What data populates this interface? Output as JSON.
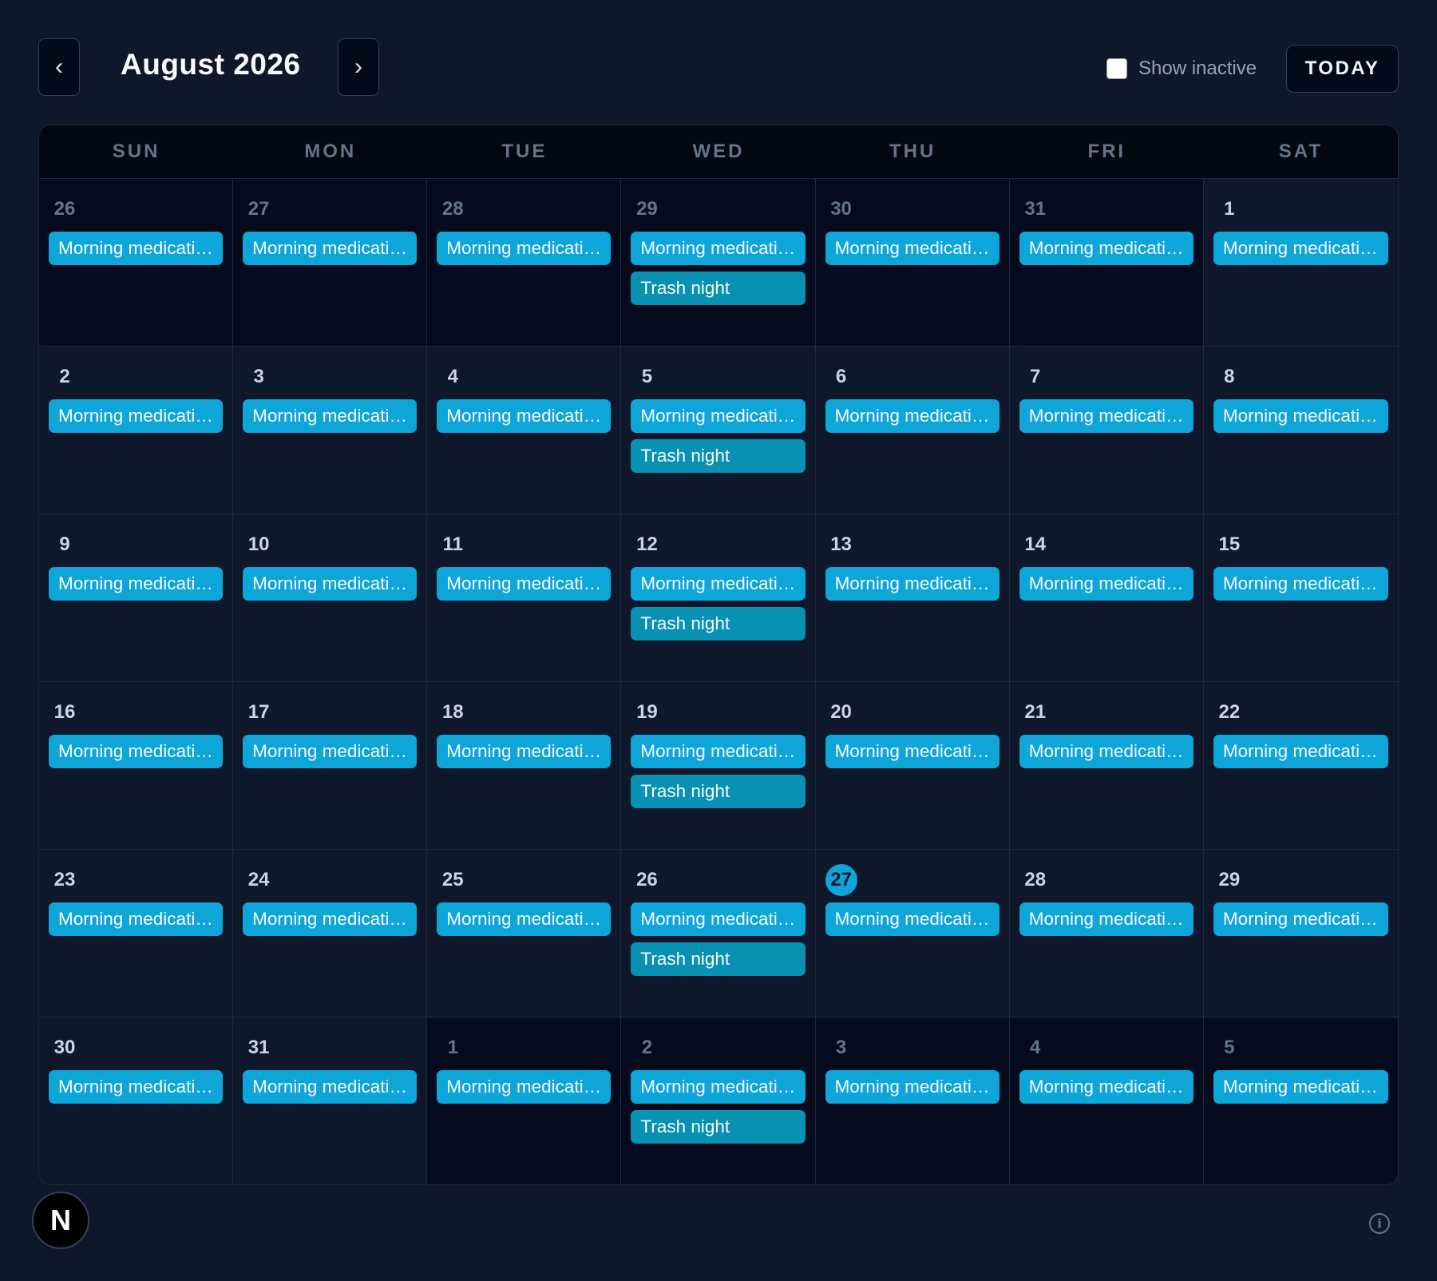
{
  "header": {
    "prev_label": "‹",
    "next_label": "›",
    "month_title": "August 2026",
    "show_inactive_label": "Show inactive",
    "show_inactive_checked": false,
    "today_label": "TODAY"
  },
  "weekdays": [
    "SUN",
    "MON",
    "TUE",
    "WED",
    "THU",
    "FRI",
    "SAT"
  ],
  "events": {
    "morning": "Morning medication",
    "trash": "Trash night"
  },
  "today_day": 27,
  "weeks": [
    [
      {
        "day": "26",
        "other": true,
        "events": [
          "morning"
        ]
      },
      {
        "day": "27",
        "other": true,
        "events": [
          "morning"
        ]
      },
      {
        "day": "28",
        "other": true,
        "events": [
          "morning"
        ]
      },
      {
        "day": "29",
        "other": true,
        "events": [
          "morning",
          "trash"
        ]
      },
      {
        "day": "30",
        "other": true,
        "events": [
          "morning"
        ]
      },
      {
        "day": "31",
        "other": true,
        "events": [
          "morning"
        ]
      },
      {
        "day": "1",
        "other": false,
        "events": [
          "morning"
        ]
      }
    ],
    [
      {
        "day": "2",
        "other": false,
        "events": [
          "morning"
        ]
      },
      {
        "day": "3",
        "other": false,
        "events": [
          "morning"
        ]
      },
      {
        "day": "4",
        "other": false,
        "events": [
          "morning"
        ]
      },
      {
        "day": "5",
        "other": false,
        "events": [
          "morning",
          "trash"
        ]
      },
      {
        "day": "6",
        "other": false,
        "events": [
          "morning"
        ]
      },
      {
        "day": "7",
        "other": false,
        "events": [
          "morning"
        ]
      },
      {
        "day": "8",
        "other": false,
        "events": [
          "morning"
        ]
      }
    ],
    [
      {
        "day": "9",
        "other": false,
        "events": [
          "morning"
        ]
      },
      {
        "day": "10",
        "other": false,
        "events": [
          "morning"
        ]
      },
      {
        "day": "11",
        "other": false,
        "events": [
          "morning"
        ]
      },
      {
        "day": "12",
        "other": false,
        "events": [
          "morning",
          "trash"
        ]
      },
      {
        "day": "13",
        "other": false,
        "events": [
          "morning"
        ]
      },
      {
        "day": "14",
        "other": false,
        "events": [
          "morning"
        ]
      },
      {
        "day": "15",
        "other": false,
        "events": [
          "morning"
        ]
      }
    ],
    [
      {
        "day": "16",
        "other": false,
        "events": [
          "morning"
        ]
      },
      {
        "day": "17",
        "other": false,
        "events": [
          "morning"
        ]
      },
      {
        "day": "18",
        "other": false,
        "events": [
          "morning"
        ]
      },
      {
        "day": "19",
        "other": false,
        "events": [
          "morning",
          "trash"
        ]
      },
      {
        "day": "20",
        "other": false,
        "events": [
          "morning"
        ]
      },
      {
        "day": "21",
        "other": false,
        "events": [
          "morning"
        ]
      },
      {
        "day": "22",
        "other": false,
        "events": [
          "morning"
        ]
      }
    ],
    [
      {
        "day": "23",
        "other": false,
        "events": [
          "morning"
        ]
      },
      {
        "day": "24",
        "other": false,
        "events": [
          "morning"
        ]
      },
      {
        "day": "25",
        "other": false,
        "events": [
          "morning"
        ]
      },
      {
        "day": "26",
        "other": false,
        "events": [
          "morning",
          "trash"
        ]
      },
      {
        "day": "27",
        "other": false,
        "today": true,
        "events": [
          "morning"
        ]
      },
      {
        "day": "28",
        "other": false,
        "events": [
          "morning"
        ]
      },
      {
        "day": "29",
        "other": false,
        "events": [
          "morning"
        ]
      }
    ],
    [
      {
        "day": "30",
        "other": false,
        "events": [
          "morning"
        ]
      },
      {
        "day": "31",
        "other": false,
        "events": [
          "morning"
        ]
      },
      {
        "day": "1",
        "other": true,
        "events": [
          "morning"
        ]
      },
      {
        "day": "2",
        "other": true,
        "events": [
          "morning",
          "trash"
        ]
      },
      {
        "day": "3",
        "other": true,
        "events": [
          "morning"
        ]
      },
      {
        "day": "4",
        "other": true,
        "events": [
          "morning"
        ]
      },
      {
        "day": "5",
        "other": true,
        "events": [
          "morning"
        ]
      }
    ]
  ],
  "footer": {
    "badge_label": "N",
    "info_icon": "info-icon"
  },
  "colors": {
    "background": "#0f172a",
    "event_medication": "#0ea5d9",
    "event_trash": "#0891b2",
    "today_highlight": "#0ea5d9"
  }
}
